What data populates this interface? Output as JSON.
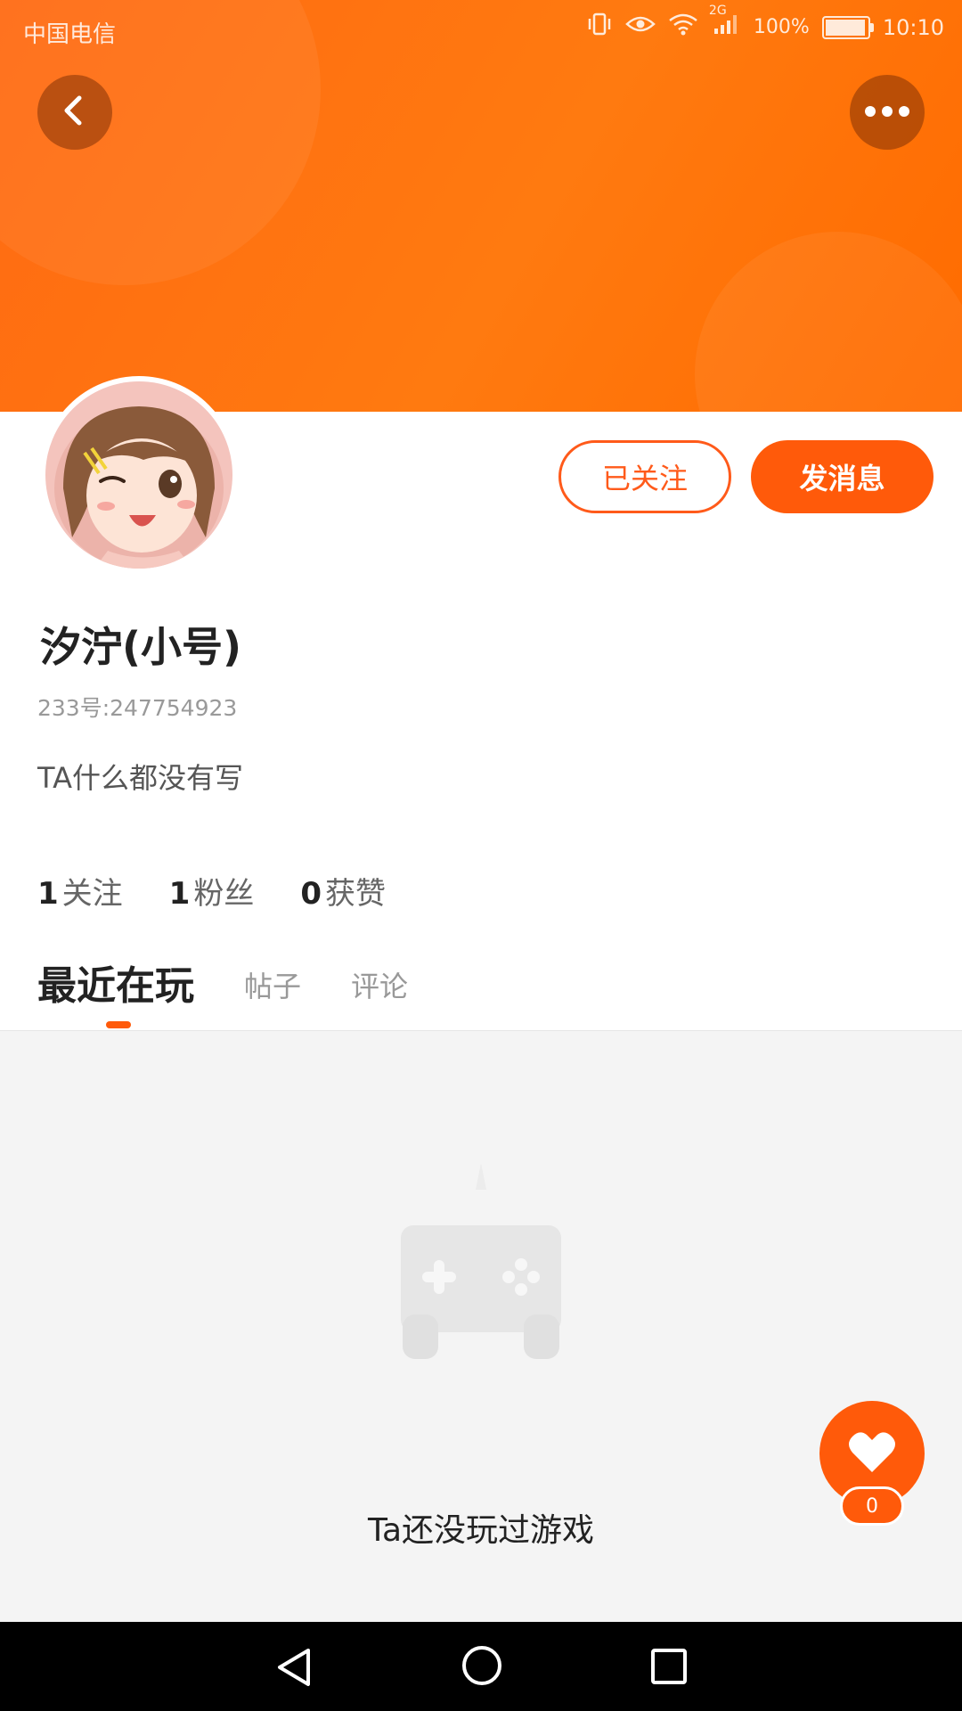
{
  "status_bar": {
    "carrier": "中国电信",
    "network": "2G",
    "battery": "100%",
    "battery_level": 0.95,
    "time": "10:10"
  },
  "header": {
    "back_icon": "chevron-left-icon",
    "more_icon": "more-dots-icon",
    "color": "#ff6a12"
  },
  "profile": {
    "name": "汐泞(小号)",
    "uid": "233号:247754923",
    "bio": "TA什么都没有写",
    "follow_button": "已关注",
    "message_button": "发消息"
  },
  "stats": [
    {
      "count": "1",
      "label": "关注"
    },
    {
      "count": "1",
      "label": "粉丝"
    },
    {
      "count": "0",
      "label": "获赞"
    }
  ],
  "tabs": [
    {
      "label": "最近在玩",
      "active": true
    },
    {
      "label": "帖子",
      "active": false
    },
    {
      "label": "评论",
      "active": false
    }
  ],
  "empty_state": {
    "icon": "gamepad-icon",
    "text": "Ta还没玩过游戏"
  },
  "like": {
    "icon": "heart-icon",
    "count": "0"
  },
  "accent_color": "#ff5a0a"
}
